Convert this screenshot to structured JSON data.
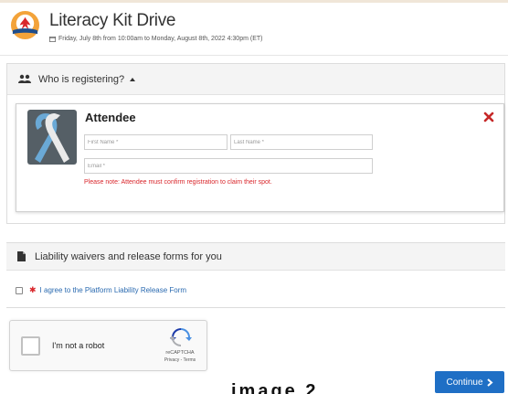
{
  "event": {
    "title": "Literacy Kit Drive",
    "date": "Friday, July 8th from 10:00am to Monday, August 8th, 2022 4:30pm (ET)"
  },
  "registration": {
    "section_title": "Who is registering?",
    "attendee": {
      "heading": "Attendee",
      "first_name_placeholder": "First Name *",
      "last_name_placeholder": "Last Name *",
      "email_placeholder": "Email *",
      "note": "Please note: Attendee must confirm registration to claim their spot."
    }
  },
  "waivers": {
    "section_title": "Liability waivers and release forms for you",
    "agree_label": "I agree to the Platform Liability Release Form",
    "checked": false
  },
  "captcha": {
    "label": "I'm not a robot",
    "brand": "reCAPTCHA",
    "terms": "Privacy - Terms"
  },
  "footer": {
    "continue_label": "Continue",
    "bottom_text": "image 2"
  },
  "colors": {
    "primary": "#1f6fc5",
    "error": "#d9262b",
    "link": "#2a6ab0"
  }
}
